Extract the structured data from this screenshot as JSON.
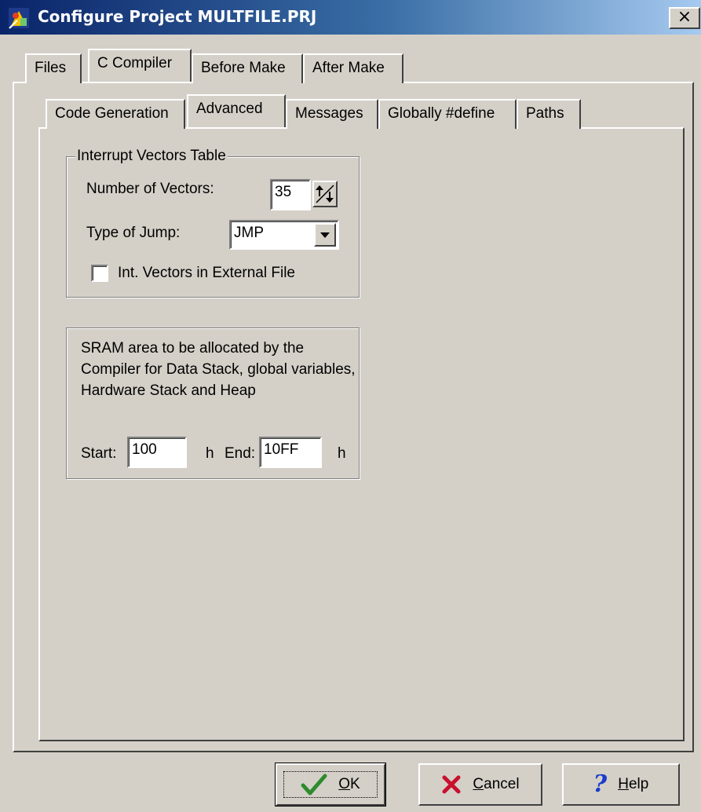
{
  "window": {
    "title": "Configure Project MULTFILE.PRJ",
    "close_label": "×"
  },
  "outer_tabs": [
    {
      "label": "Files",
      "active": false
    },
    {
      "label": "C Compiler",
      "active": true
    },
    {
      "label": "Before Make",
      "active": false
    },
    {
      "label": "After Make",
      "active": false
    }
  ],
  "inner_tabs": [
    {
      "label": "Code Generation",
      "active": false
    },
    {
      "label": "Advanced",
      "active": true
    },
    {
      "label": "Messages",
      "active": false
    },
    {
      "label": "Globally #define",
      "active": false
    },
    {
      "label": "Paths",
      "active": false
    }
  ],
  "interrupt_group": {
    "title": "Interrupt Vectors Table",
    "num_vectors_label": "Number of Vectors:",
    "num_vectors_value": "35",
    "jump_type_label": "Type of Jump:",
    "jump_type_value": "JMP",
    "external_file_label": "Int. Vectors in External File",
    "external_file_checked": false
  },
  "sram_group": {
    "description": "SRAM area to be allocated by the Compiler for Data Stack, global variables, Hardware Stack and Heap",
    "start_label": "Start:",
    "start_value": "100",
    "start_suffix": "h",
    "end_label": "End:",
    "end_value": "10FF",
    "end_suffix": "h"
  },
  "buttons": {
    "ok_mnemonic": "O",
    "ok_rest": "K",
    "cancel_mnemonic": "C",
    "cancel_rest": "ancel",
    "help_mnemonic": "H",
    "help_rest": "elp"
  },
  "icons": {
    "ok": "checkmark-icon",
    "cancel": "x-cross-icon",
    "help": "question-mark-icon",
    "spin": "up-down-arrows-icon",
    "dropdown": "chevron-down-icon"
  },
  "colors": {
    "face": "#d4d0c8",
    "title_start": "#0a246a",
    "title_end": "#a6caf0",
    "ok_green": "#2e8b2e",
    "cancel_red": "#c8102e",
    "help_blue": "#1a3ccc"
  }
}
